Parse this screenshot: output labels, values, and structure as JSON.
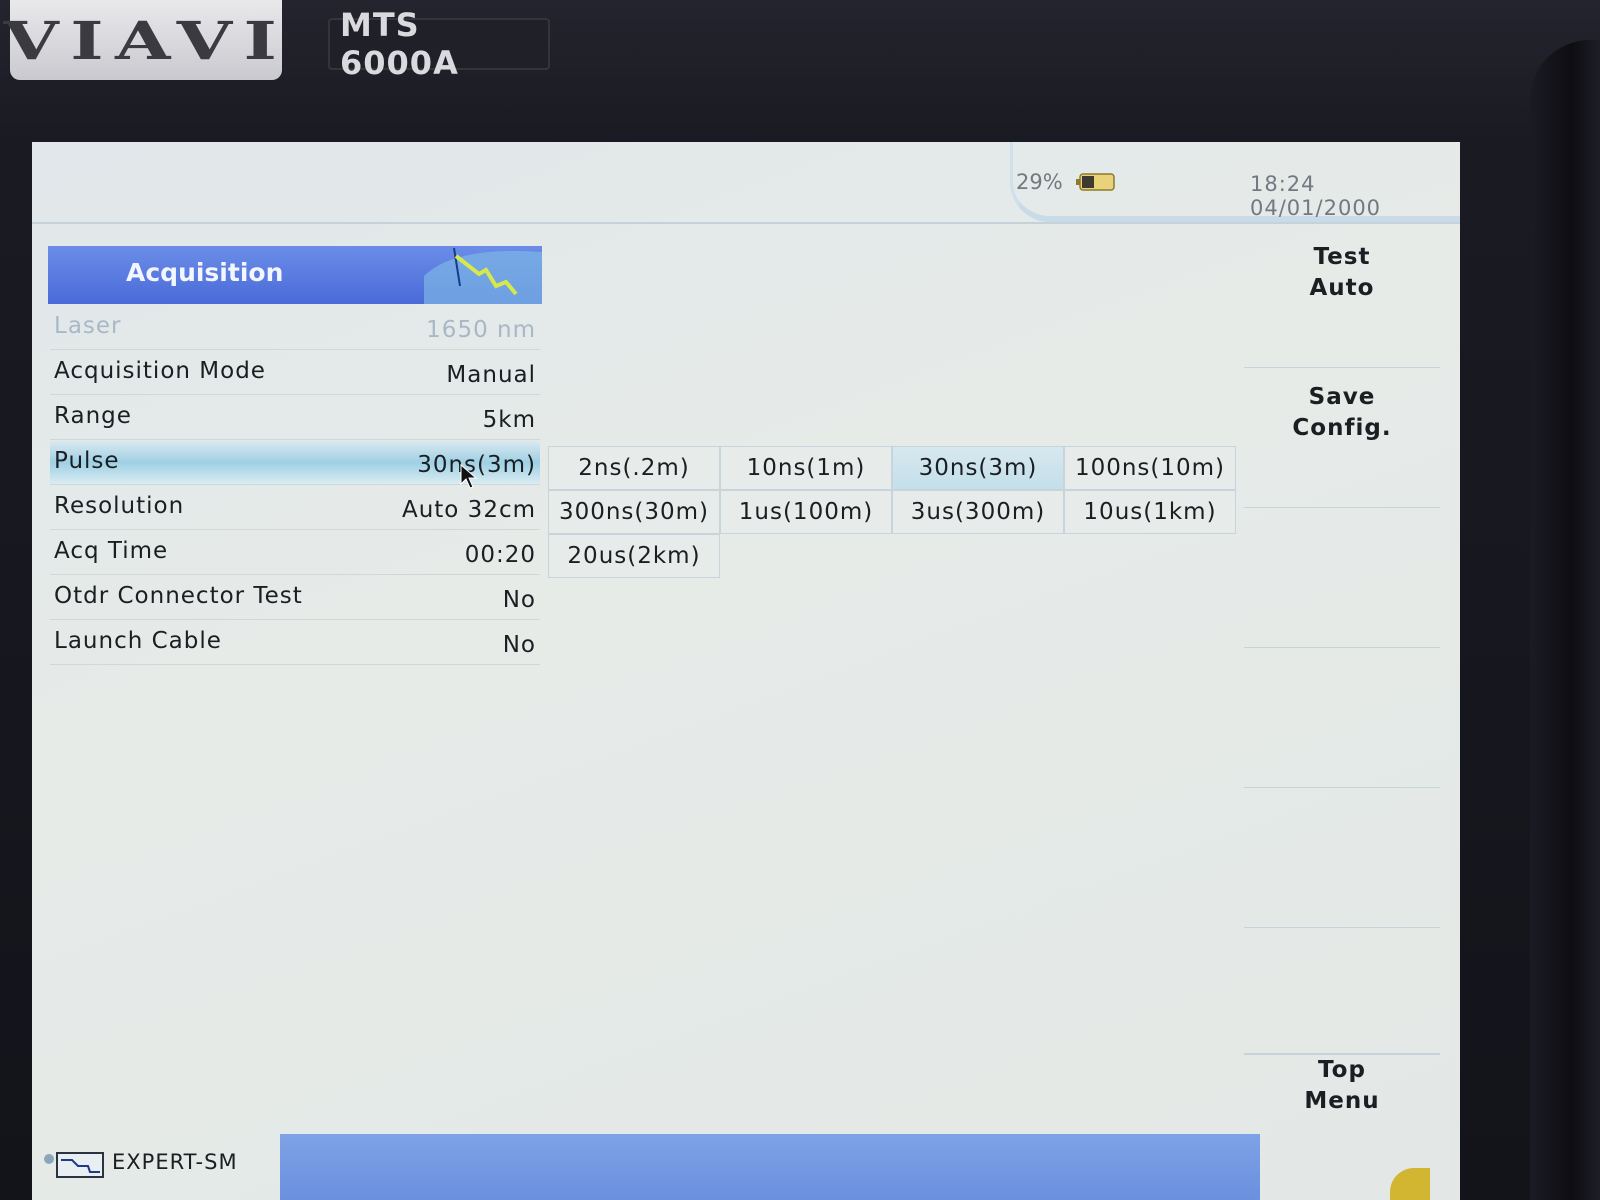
{
  "device": {
    "logo": "VIAVI",
    "model": "MTS 6000A"
  },
  "status": {
    "battery": "29%",
    "time": "18:24",
    "date": "04/01/2000"
  },
  "panel": {
    "title": "Acquisition",
    "rows": [
      {
        "label": "Laser",
        "value": "1650 nm"
      },
      {
        "label": "Acquisition Mode",
        "value": "Manual"
      },
      {
        "label": "Range",
        "value": "5km"
      },
      {
        "label": "Pulse",
        "value": "30ns(3m)"
      },
      {
        "label": "Resolution",
        "value": "Auto 32cm"
      },
      {
        "label": "Acq Time",
        "value": "00:20"
      },
      {
        "label": "Otdr Connector Test",
        "value": "No"
      },
      {
        "label": "Launch Cable",
        "value": "No"
      }
    ]
  },
  "pulse_options": [
    "2ns(.2m)",
    "10ns(1m)",
    "30ns(3m)",
    "100ns(10m)",
    "300ns(30m)",
    "1us(100m)",
    "3us(300m)",
    "10us(1km)",
    "20us(2km)"
  ],
  "softkeys": {
    "test_auto": "Test\nAuto",
    "save_config": "Save\nConfig.",
    "top_menu": "Top\nMenu"
  },
  "footer": {
    "mode": "EXPERT-SM"
  },
  "colors": {
    "header_blue": "#4a6ad8",
    "selected_row": "#9fd0e4",
    "bottom_bar": "#6a90de"
  }
}
